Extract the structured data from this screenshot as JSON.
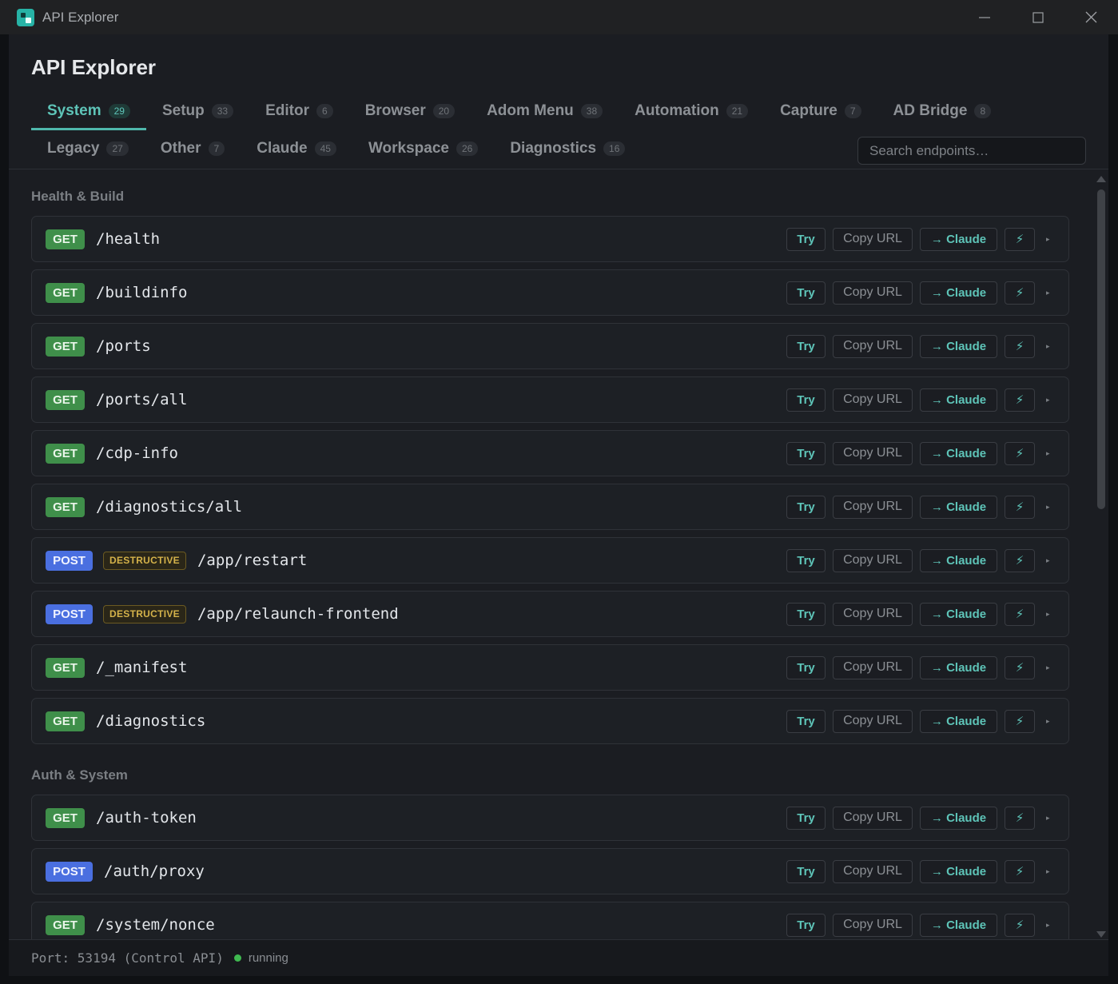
{
  "window": {
    "title": "API Explorer"
  },
  "page": {
    "title": "API Explorer"
  },
  "tabs_row1": [
    {
      "label": "System",
      "count": "29",
      "active": true
    },
    {
      "label": "Setup",
      "count": "33"
    },
    {
      "label": "Editor",
      "count": "6"
    },
    {
      "label": "Browser",
      "count": "20"
    },
    {
      "label": "Adom Menu",
      "count": "38"
    },
    {
      "label": "Automation",
      "count": "21"
    },
    {
      "label": "Capture",
      "count": "7"
    },
    {
      "label": "AD Bridge",
      "count": "8"
    }
  ],
  "tabs_row2": [
    {
      "label": "Legacy",
      "count": "27"
    },
    {
      "label": "Other",
      "count": "7"
    },
    {
      "label": "Claude",
      "count": "45"
    },
    {
      "label": "Workspace",
      "count": "26"
    },
    {
      "label": "Diagnostics",
      "count": "16"
    }
  ],
  "search": {
    "placeholder": "Search endpoints…"
  },
  "actions": {
    "try": "Try",
    "copy": "Copy URL",
    "claude": "→ Claude",
    "bolt": "⚡",
    "expand": "▸"
  },
  "sections": [
    {
      "title": "Health & Build",
      "endpoints": [
        {
          "method": "GET",
          "path": "/health"
        },
        {
          "method": "GET",
          "path": "/buildinfo"
        },
        {
          "method": "GET",
          "path": "/ports"
        },
        {
          "method": "GET",
          "path": "/ports/all"
        },
        {
          "method": "GET",
          "path": "/cdp-info"
        },
        {
          "method": "GET",
          "path": "/diagnostics/all"
        },
        {
          "method": "POST",
          "path": "/app/restart",
          "badge": "DESTRUCTIVE"
        },
        {
          "method": "POST",
          "path": "/app/relaunch-frontend",
          "badge": "DESTRUCTIVE"
        },
        {
          "method": "GET",
          "path": "/_manifest"
        },
        {
          "method": "GET",
          "path": "/diagnostics"
        }
      ]
    },
    {
      "title": "Auth & System",
      "endpoints": [
        {
          "method": "GET",
          "path": "/auth-token"
        },
        {
          "method": "POST",
          "path": "/auth/proxy"
        },
        {
          "method": "GET",
          "path": "/system/nonce"
        }
      ]
    }
  ],
  "footer": {
    "port": "Port: 53194 (Control API)",
    "status": "running"
  },
  "colors": {
    "accent": "#5ec4b8",
    "get": "#3f8f4a",
    "post": "#4a6fe0",
    "destructive": "#d4b24a",
    "running": "#3fb950"
  }
}
